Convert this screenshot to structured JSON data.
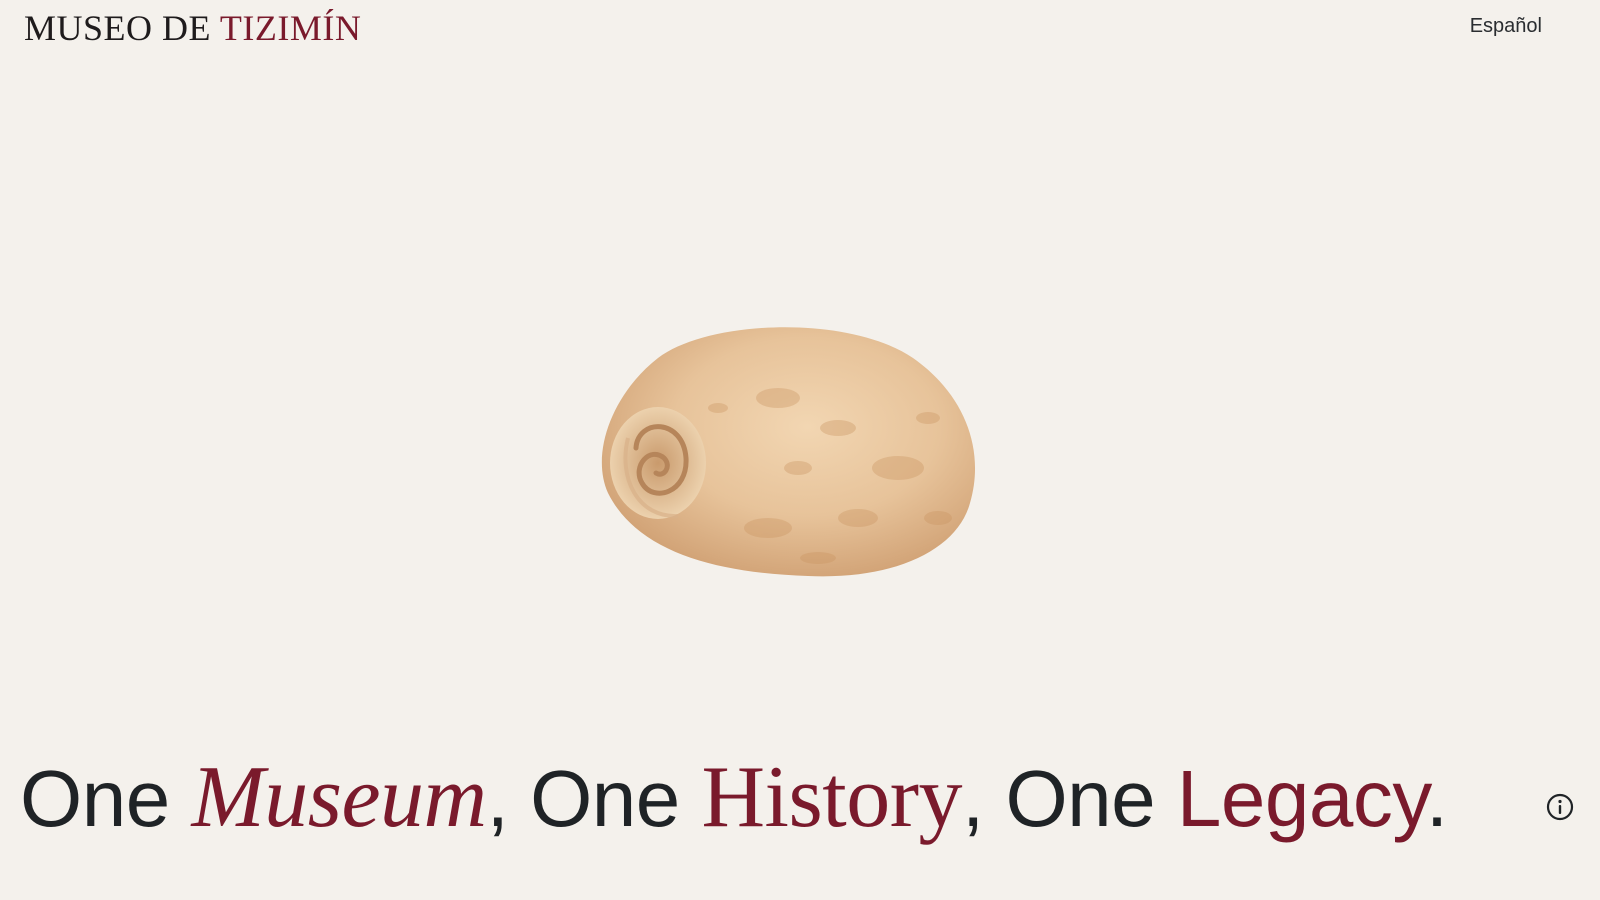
{
  "header": {
    "logo_part1": "MUSEO DE ",
    "logo_part2": "TIZIMÍN",
    "language_link": "Español"
  },
  "hero": {
    "artifact_icon": "shell-artifact",
    "headline": {
      "w1": "One ",
      "w2": "Museum",
      "w3": ", One ",
      "w4": "History",
      "w5": ", One ",
      "w6": "Legacy",
      "w7": "."
    },
    "info_icon": "info-icon"
  },
  "colors": {
    "background": "#f4f1ec",
    "text": "#1f2326",
    "accent": "#7a1a2c",
    "artifact": "#e8c9a4"
  }
}
